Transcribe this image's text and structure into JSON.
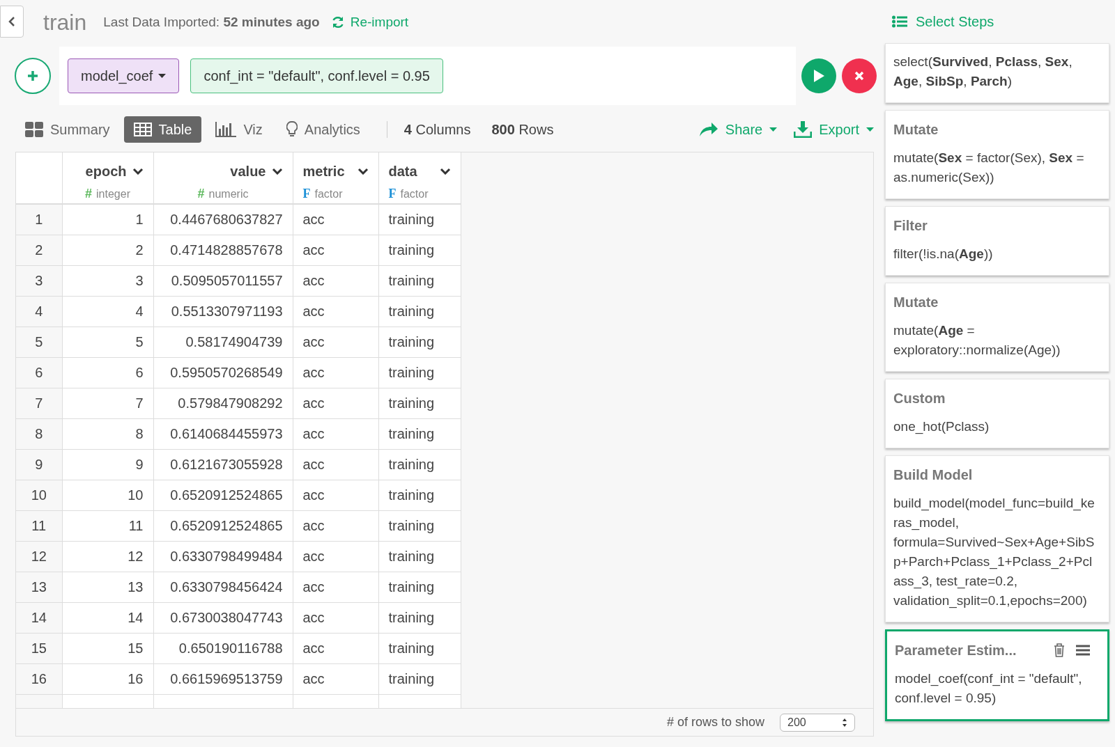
{
  "header": {
    "title": "train",
    "import_status": "Last Data Imported: **52 minutes ago**",
    "reimport": "Re-import"
  },
  "command": {
    "function": "model_coef",
    "arguments": "conf_int = \"default\", conf.level = 0.95"
  },
  "tabs": [
    {
      "label": "Summary",
      "selected": false,
      "kind": "summary"
    },
    {
      "label": "Table",
      "selected": true,
      "kind": "table"
    },
    {
      "label": "Viz",
      "selected": false,
      "kind": "viz"
    },
    {
      "label": "Analytics",
      "selected": false,
      "kind": "analytics"
    }
  ],
  "counts": [
    "**4** Columns",
    "**800** Rows"
  ],
  "actions": [
    {
      "label": "Share",
      "kind": "share"
    },
    {
      "label": "Export",
      "kind": "export"
    }
  ],
  "table": {
    "columns": [
      {
        "kind": "index"
      },
      {
        "name": "epoch",
        "type": "integer",
        "type_icon": "#",
        "kind": "number"
      },
      {
        "name": "value",
        "type": "numeric",
        "type_icon": "#",
        "kind": "number"
      },
      {
        "name": "metric",
        "type": "factor",
        "type_icon": "F",
        "kind": "factor"
      },
      {
        "name": "data",
        "type": "factor",
        "type_icon": "F",
        "kind": "factor"
      }
    ],
    "rows": [
      [
        "1",
        "1",
        "0.4467680637827",
        "acc",
        "training"
      ],
      [
        "2",
        "2",
        "0.4714828857678",
        "acc",
        "training"
      ],
      [
        "3",
        "3",
        "0.5095057011557",
        "acc",
        "training"
      ],
      [
        "4",
        "4",
        "0.5513307971193",
        "acc",
        "training"
      ],
      [
        "5",
        "5",
        "0.58174904739",
        "acc",
        "training"
      ],
      [
        "6",
        "6",
        "0.5950570268549",
        "acc",
        "training"
      ],
      [
        "7",
        "7",
        "0.579847908292",
        "acc",
        "training"
      ],
      [
        "8",
        "8",
        "0.6140684455973",
        "acc",
        "training"
      ],
      [
        "9",
        "9",
        "0.6121673055928",
        "acc",
        "training"
      ],
      [
        "10",
        "10",
        "0.6520912524865",
        "acc",
        "training"
      ],
      [
        "11",
        "11",
        "0.6520912524865",
        "acc",
        "training"
      ],
      [
        "12",
        "12",
        "0.6330798499484",
        "acc",
        "training"
      ],
      [
        "13",
        "13",
        "0.6330798456424",
        "acc",
        "training"
      ],
      [
        "14",
        "14",
        "0.6730038047743",
        "acc",
        "training"
      ],
      [
        "15",
        "15",
        "0.650190116788",
        "acc",
        "training"
      ],
      [
        "16",
        "16",
        "0.6615969513759",
        "acc",
        "training"
      ]
    ]
  },
  "footer": {
    "label": "# of rows to show",
    "rows_to_show": "200"
  },
  "steps_panel": {
    "title": "Select Steps",
    "steps": [
      {
        "code": "select(**Survived**, **Pclass**, **Sex**, **Age**, **SibSp**, **Parch**)",
        "selected": false
      },
      {
        "title": "Mutate",
        "code": "mutate(**Sex** = factor(Sex), **Sex** = as.numeric(Sex))",
        "selected": false
      },
      {
        "title": "Filter",
        "code": "filter(!is.na(**Age**))",
        "selected": false
      },
      {
        "title": "Mutate",
        "code": "mutate(**Age** = exploratory::normalize(Age))",
        "selected": false
      },
      {
        "title": "Custom",
        "code": "one_hot(Pclass)",
        "selected": false
      },
      {
        "title": "Build Model",
        "code": "build_model(model_func=build_keras_model, formula=Survived~Sex+Age+SibSp+Parch+Pclass_1+Pclass_2+Pclass_3, test_rate=0.2, validation_split=0.1,epochs=200)",
        "selected": false
      },
      {
        "title": "Parameter Estim...",
        "code": "model_coef(conf_int = \"default\", conf.level = 0.95)",
        "selected": true
      }
    ]
  }
}
